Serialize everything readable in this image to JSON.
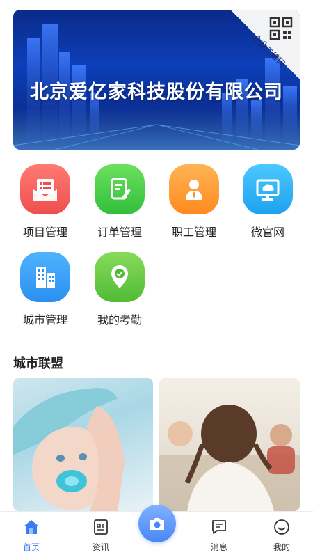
{
  "banner": {
    "company_name": "北京爱亿家科技股份有限公司",
    "corner_label": "企业二维码",
    "qr_icon": "qr-code-icon"
  },
  "menu": [
    {
      "label": "项目管理",
      "icon": "envelope-list-icon",
      "color": "#f0615f"
    },
    {
      "label": "订单管理",
      "icon": "edit-document-icon",
      "color": "#4fcf4f"
    },
    {
      "label": "职工管理",
      "icon": "person-icon",
      "color": "#ff9a3c"
    },
    {
      "label": "微官网",
      "icon": "cloud-monitor-icon",
      "color": "#31b6f2"
    },
    {
      "label": "城市管理",
      "icon": "buildings-icon",
      "color": "#3a9ef0"
    },
    {
      "label": "我的考勤",
      "icon": "location-check-icon",
      "color": "#6ccc45"
    }
  ],
  "section": {
    "title": "城市联盟"
  },
  "tabs": [
    {
      "label": "首页",
      "icon": "home-icon"
    },
    {
      "label": "资讯",
      "icon": "news-icon"
    },
    {
      "label": "",
      "icon": "camera-icon"
    },
    {
      "label": "消息",
      "icon": "message-icon"
    },
    {
      "label": "我的",
      "icon": "smile-icon"
    }
  ],
  "colors": {
    "accent": "#3b7df0",
    "banner_dark": "#0a2a8a"
  }
}
